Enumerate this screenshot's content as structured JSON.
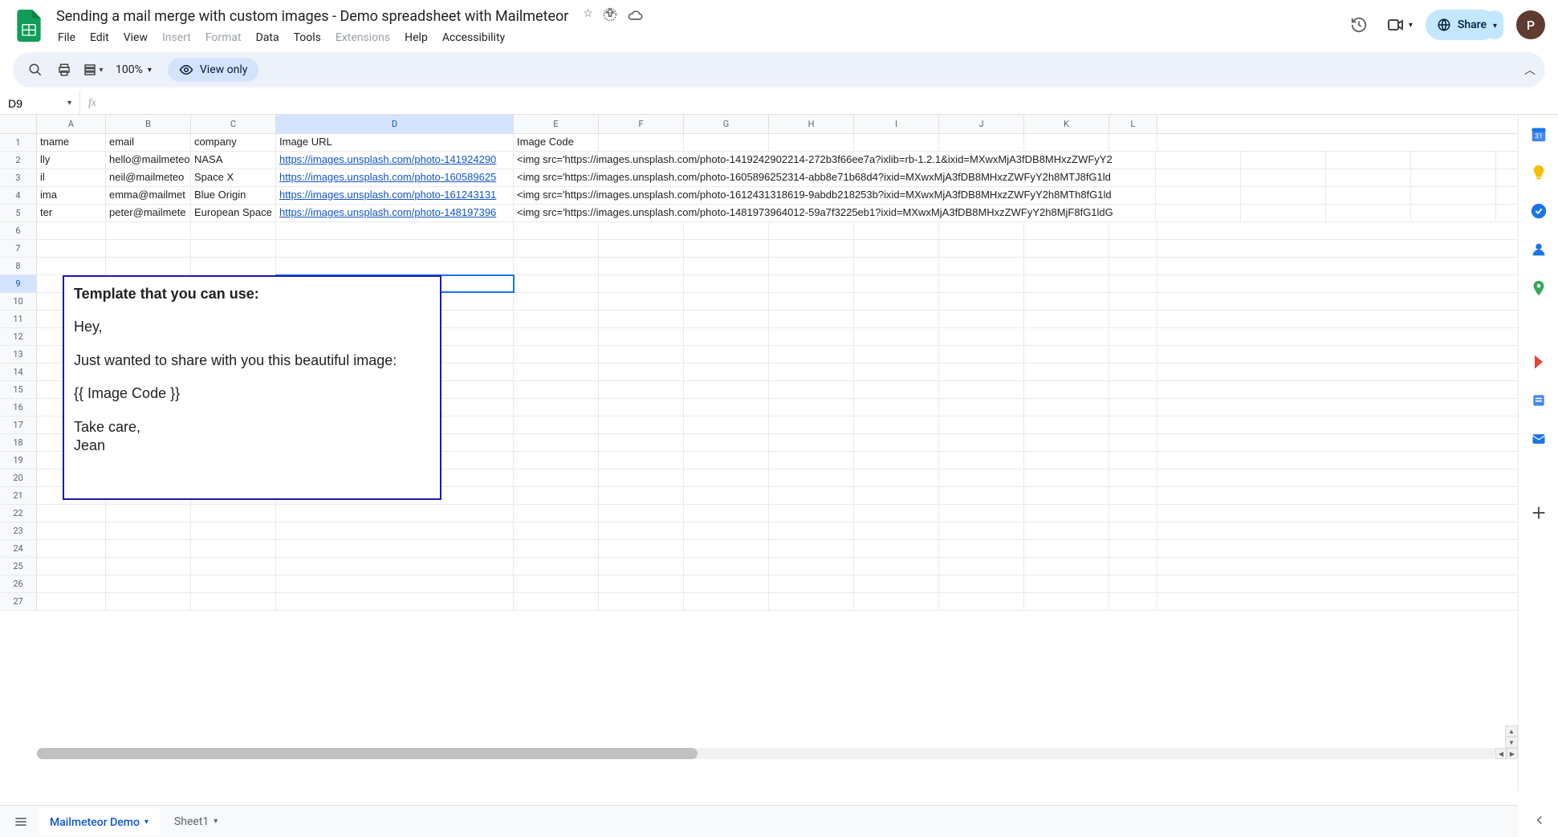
{
  "doc": {
    "title": "Sending a mail merge with custom images - Demo spreadsheet with Mailmeteor"
  },
  "menubar": {
    "file": "File",
    "edit": "Edit",
    "view": "View",
    "insert": "Insert",
    "format": "Format",
    "data": "Data",
    "tools": "Tools",
    "extensions": "Extensions",
    "help": "Help",
    "accessibility": "Accessibility"
  },
  "header": {
    "share": "Share",
    "avatar_initial": "P"
  },
  "toolbar": {
    "zoom": "100%",
    "view_only": "View only"
  },
  "namebox": {
    "ref": "D9"
  },
  "columns": [
    "A",
    "B",
    "C",
    "D",
    "E",
    "F",
    "G",
    "H",
    "I",
    "J",
    "K",
    "L"
  ],
  "col_selected": "D",
  "active_row": 9,
  "headers_row": {
    "A": "tname",
    "B": "email",
    "C": "company",
    "D": "Image URL",
    "E": "Image Code"
  },
  "rows": [
    {
      "A": "lly",
      "B": "hello@mailmeteo",
      "C": "NASA",
      "D": "https://images.unsplash.com/photo-141924290",
      "E": "<img src='https://images.unsplash.com/photo-1419242902214-272b3f66ee7a?ixlib=rb-1.2.1&ixid=MXwxMjA3fDB8MHxzZWFyY2"
    },
    {
      "A": "il",
      "B": "neil@mailmeteo",
      "C": "Space X",
      "D": "https://images.unsplash.com/photo-160589625",
      "E": "<img src='https://images.unsplash.com/photo-1605896252314-abb8e71b68d4?ixid=MXwxMjA3fDB8MHxzZWFyY2h8MTJ8fG1ld"
    },
    {
      "A": "ima",
      "B": "emma@mailmet",
      "C": "Blue Origin",
      "D": "https://images.unsplash.com/photo-161243131",
      "E": "<img src='https://images.unsplash.com/photo-1612431318619-9abdb218253b?ixid=MXwxMjA3fDB8MHxzZWFyY2h8MTh8fG1ld"
    },
    {
      "A": "ter",
      "B": "peter@mailmete",
      "C": "European Space",
      "D": "https://images.unsplash.com/photo-148197396",
      "E": "<img src='https://images.unsplash.com/photo-1481973964012-59a7f3225eb1?ixid=MXwxMjA3fDB8MHxzZWFyY2h8MjF8fG1ldG"
    }
  ],
  "template_box": {
    "title": "Template that you can use:",
    "line1": "Hey,",
    "line2": "Just wanted to share with you this beautiful image:",
    "line3": "{{ Image Code }}",
    "line4": "Take care,",
    "line5": "Jean"
  },
  "sheets": {
    "tab1": "Mailmeteor Demo",
    "tab2": "Sheet1"
  }
}
